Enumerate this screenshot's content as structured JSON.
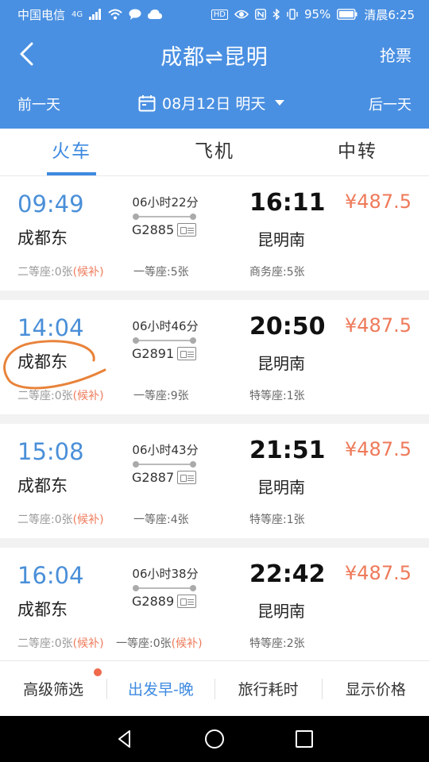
{
  "status_bar": {
    "carrier": "中国电信",
    "network": "4G",
    "battery": "95%",
    "time": "清晨6:25",
    "icons": [
      "signal-icon",
      "wifi-icon",
      "message-icon",
      "cloud-icon",
      "hd-icon",
      "eye-icon",
      "nfc-icon",
      "bluetooth-icon",
      "vibrate-icon",
      "battery-icon"
    ]
  },
  "header": {
    "back_icon": "chevron-left-icon",
    "title": "成都⇌昆明",
    "grab_ticket": "抢票",
    "prev_day": "前一天",
    "next_day": "后一天",
    "date_label": "08月12日 明天"
  },
  "tabs": [
    {
      "label": "火车",
      "active": true
    },
    {
      "label": "飞机",
      "active": false
    },
    {
      "label": "中转",
      "active": false
    }
  ],
  "trains": [
    {
      "dep_time": "09:49",
      "dep_station": "成都东",
      "duration": "06小时22分",
      "train_no": "G2885",
      "arr_time": "16:11",
      "arr_station": "昆明南",
      "price": "¥487.5",
      "seat1_name": "二等座:0张",
      "seat1_tag": "(候补)",
      "seat2_name": "一等座:5张",
      "seat2_tag": "",
      "seat3_name": "商务座:5张"
    },
    {
      "dep_time": "14:04",
      "dep_station": "成都东",
      "duration": "06小时46分",
      "train_no": "G2891",
      "arr_time": "20:50",
      "arr_station": "昆明南",
      "price": "¥487.5",
      "seat1_name": "二等座:0张",
      "seat1_tag": "(候补)",
      "seat2_name": "一等座:9张",
      "seat2_tag": "",
      "seat3_name": "特等座:1张"
    },
    {
      "dep_time": "15:08",
      "dep_station": "成都东",
      "duration": "06小时43分",
      "train_no": "G2887",
      "arr_time": "21:51",
      "arr_station": "昆明南",
      "price": "¥487.5",
      "seat1_name": "二等座:0张",
      "seat1_tag": "(候补)",
      "seat2_name": "一等座:4张",
      "seat2_tag": "",
      "seat3_name": "特等座:1张"
    },
    {
      "dep_time": "16:04",
      "dep_station": "成都东",
      "duration": "06小时38分",
      "train_no": "G2889",
      "arr_time": "22:42",
      "arr_station": "昆明南",
      "price": "¥487.5",
      "seat1_name": "二等座:0张",
      "seat1_tag": "(候补)",
      "seat2_name": "一等座:0张",
      "seat2_tag": "(候补)",
      "seat3_name": "特等座:2张"
    }
  ],
  "filter_bar": [
    {
      "label": "高级筛选",
      "active": false,
      "badge": true
    },
    {
      "label": "出发早-晚",
      "active": true
    },
    {
      "label": "旅行耗时",
      "active": false
    },
    {
      "label": "显示价格",
      "active": false
    }
  ],
  "colors": {
    "header_bg": "#4a90e2",
    "accent": "#3d8ae0",
    "price": "#ee7a5a",
    "annotation": "#e8833a"
  }
}
